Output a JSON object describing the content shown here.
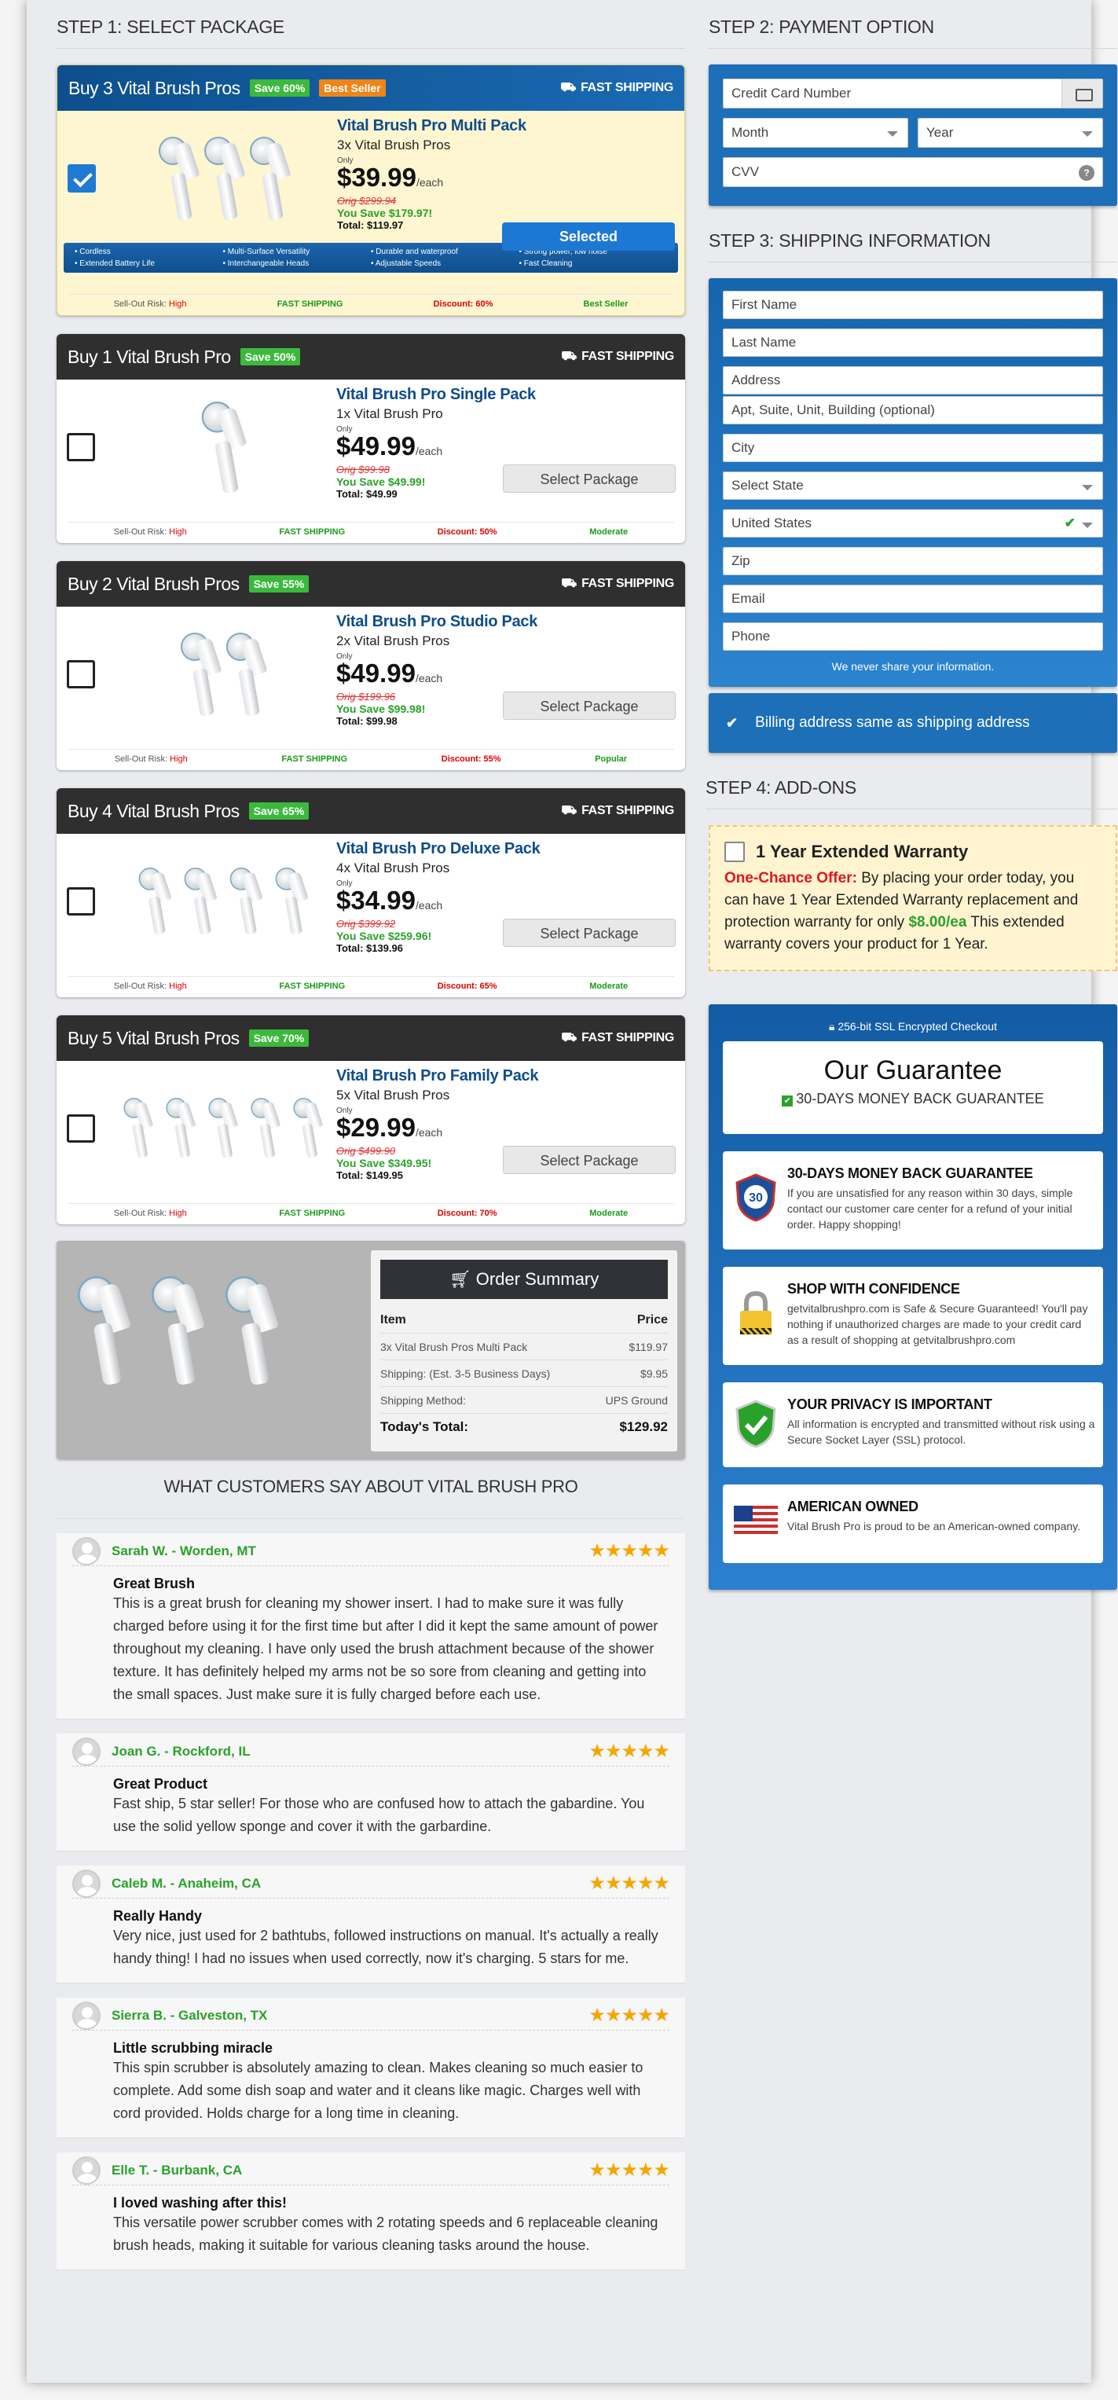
{
  "steps": {
    "s1": "STEP 1: SELECT PACKAGE",
    "s2": "STEP 2: PAYMENT OPTION",
    "s3": "STEP 3: SHIPPING INFORMATION",
    "s4": "STEP 4: ADD-ONS"
  },
  "packages": [
    {
      "head": "Buy 3 Vital Brush Pros",
      "save_badge": "Save 60%",
      "best_badge": "Best Seller",
      "shipping": "FAST SHIPPING",
      "name": "Vital Brush Pro Multi Pack",
      "qty": "3x Vital Brush Pros",
      "only": "Only",
      "price": "$39.99",
      "each": "/each",
      "orig": "Orig $299.94",
      "save": "You Save $179.97!",
      "total": "Total: $119.97",
      "button": "Selected",
      "features": [
        "Cordless",
        "Multi-Surface Versatility",
        "Durable and waterproof",
        "Strong power, low noise",
        "Extended Battery Life",
        "Interchangeable Heads",
        "Adjustable Speeds",
        "Fast Cleaning"
      ],
      "risk_label": "Sell-Out Risk:",
      "risk": "High",
      "fast": "FAST SHIPPING",
      "discount": "Discount: 60%",
      "popularity": "Best Seller",
      "selected": true
    },
    {
      "head": "Buy 1 Vital Brush Pro",
      "save_badge": "Save 50%",
      "shipping": "FAST SHIPPING",
      "name": "Vital Brush Pro Single Pack",
      "qty": "1x Vital Brush Pro",
      "only": "Only",
      "price": "$49.99",
      "each": "/each",
      "orig": "Orig $99.98",
      "save": "You Save $49.99!",
      "total": "Total: $49.99",
      "button": "Select Package",
      "risk_label": "Sell-Out Risk:",
      "risk": "High",
      "fast": "FAST SHIPPING",
      "discount": "Discount: 50%",
      "popularity": "Moderate",
      "selected": false
    },
    {
      "head": "Buy 2 Vital Brush Pros",
      "save_badge": "Save 55%",
      "shipping": "FAST SHIPPING",
      "name": "Vital Brush Pro Studio Pack",
      "qty": "2x Vital Brush Pros",
      "only": "Only",
      "price": "$49.99",
      "each": "/each",
      "orig": "Orig $199.96",
      "save": "You Save $99.98!",
      "total": "Total: $99.98",
      "button": "Select Package",
      "risk_label": "Sell-Out Risk:",
      "risk": "High",
      "fast": "FAST SHIPPING",
      "discount": "Discount: 55%",
      "popularity": "Popular",
      "selected": false
    },
    {
      "head": "Buy 4 Vital Brush Pros",
      "save_badge": "Save 65%",
      "shipping": "FAST SHIPPING",
      "name": "Vital Brush Pro Deluxe Pack",
      "qty": "4x Vital Brush Pros",
      "only": "Only",
      "price": "$34.99",
      "each": "/each",
      "orig": "Orig $399.92",
      "save": "You Save $259.96!",
      "total": "Total: $139.96",
      "button": "Select Package",
      "risk_label": "Sell-Out Risk:",
      "risk": "High",
      "fast": "FAST SHIPPING",
      "discount": "Discount: 65%",
      "popularity": "Moderate",
      "selected": false
    },
    {
      "head": "Buy 5 Vital Brush Pros",
      "save_badge": "Save 70%",
      "shipping": "FAST SHIPPING",
      "name": "Vital Brush Pro Family Pack",
      "qty": "5x Vital Brush Pros",
      "only": "Only",
      "price": "$29.99",
      "each": "/each",
      "orig": "Orig $499.90",
      "save": "You Save $349.95!",
      "total": "Total: $149.95",
      "button": "Select Package",
      "risk_label": "Sell-Out Risk:",
      "risk": "High",
      "fast": "FAST SHIPPING",
      "discount": "Discount: 70%",
      "popularity": "Moderate",
      "selected": false
    }
  ],
  "order_summary": {
    "title": "Order Summary",
    "col_item": "Item",
    "col_price": "Price",
    "rows": [
      {
        "label": "3x Vital Brush Pros Multi Pack",
        "value": "$119.97"
      },
      {
        "label": "Shipping: (Est. 3-5 Business Days)",
        "value": "$9.95"
      },
      {
        "label": "Shipping Method:",
        "value": "UPS Ground"
      }
    ],
    "total_label": "Today's Total:",
    "total_value": "$129.92"
  },
  "reviews_title": "WHAT CUSTOMERS SAY ABOUT VITAL BRUSH PRO",
  "reviews": [
    {
      "name": "Sarah W. - Worden, MT",
      "stars": "★★★★★",
      "title": "Great Brush",
      "text": "This is a great brush for cleaning my shower insert. I had to make sure it was fully charged before using it for the first time but after I did it kept the same amount of power throughout my cleaning. I have only used the brush attachment because of the shower texture. It has definitely helped my arms not be so sore from cleaning and getting into the small spaces. Just make sure it is fully charged before each use."
    },
    {
      "name": "Joan G. - Rockford, IL",
      "stars": "★★★★★",
      "title": "Great Product",
      "text": "Fast ship, 5 star seller! For those who are confused how to attach the gabardine. You use the solid yellow sponge and cover it with the garbardine."
    },
    {
      "name": "Caleb M. - Anaheim, CA",
      "stars": "★★★★★",
      "title": "Really Handy",
      "text": "Very nice, just used for 2 bathtubs, followed instructions on manual. It's actually a really handy thing! I had no issues when used correctly, now it's charging. 5 stars for me."
    },
    {
      "name": "Sierra B. - Galveston, TX",
      "stars": "★★★★★",
      "title": "Little scrubbing miracle",
      "text": "This spin scrubber is absolutely amazing to clean. Makes cleaning so much easier to complete. Add some dish soap and water and it cleans like magic. Charges well with cord provided. Holds charge for a long time in cleaning."
    },
    {
      "name": "Elle T. - Burbank, CA",
      "stars": "★★★★★",
      "title": "I loved washing after this!",
      "text": "This versatile power scrubber comes with 2 rotating speeds and 6 replaceable cleaning brush heads, making it suitable for various cleaning tasks around the house."
    }
  ],
  "payment": {
    "card_placeholder": "Credit Card Number",
    "month": "Month",
    "year": "Year",
    "cvv": "CVV",
    "cvv_help": "?"
  },
  "shipping": {
    "first": "First Name",
    "last": "Last Name",
    "address": "Address",
    "address2": "Apt, Suite, Unit, Building (optional)",
    "city": "City",
    "state": "Select State",
    "country": "United States",
    "zip": "Zip",
    "email": "Email",
    "phone": "Phone",
    "privacy": "We never share your information.",
    "billing": "Billing address same as shipping address"
  },
  "addon": {
    "title": "1 Year Extended Warranty",
    "offer_label": "One-Chance Offer:",
    "text_a": "By placing your order today, you can have 1 Year Extended Warranty replacement and protection warranty for only",
    "price": "$8.00/ea",
    "text_b": "This extended warranty covers your product for 1 Year."
  },
  "guarantee": {
    "ssl": "256-bit SSL Encrypted Checkout",
    "title": "Our Guarantee",
    "subtitle": "30-DAYS MONEY BACK GUARANTEE",
    "badge_number": "30",
    "items": [
      {
        "title": "30-DAYS MONEY BACK GUARANTEE",
        "text": "If you are unsatisfied for any reason within 30 days, simple contact our customer care center for a refund of your initial order. Happy shopping!"
      },
      {
        "title": "SHOP WITH CONFIDENCE",
        "text": "getvitalbrushpro.com is Safe & Secure Guaranteed! You'll pay nothing if unauthorized charges are made to your credit card as a result of shopping at getvitalbrushpro.com"
      },
      {
        "title": "YOUR PRIVACY IS IMPORTANT",
        "text": "All information is encrypted and transmitted without risk using a Secure Socket Layer (SSL) protocol."
      },
      {
        "title": "AMERICAN OWNED",
        "text": "Vital Brush Pro is proud to be an American-owned company."
      }
    ]
  },
  "colors": {
    "accent_blue": "#1d6fb8",
    "green": "#2aa12a",
    "red": "#e0161e",
    "star": "#f6a500"
  },
  "icons": [
    "truck-icon",
    "card-icon",
    "help-icon",
    "checkmark-icon",
    "lock-icon",
    "shield-30-icon",
    "padlock-icon",
    "privacy-shield-icon",
    "us-flag-icon",
    "cart-icon",
    "avatar-icon"
  ]
}
